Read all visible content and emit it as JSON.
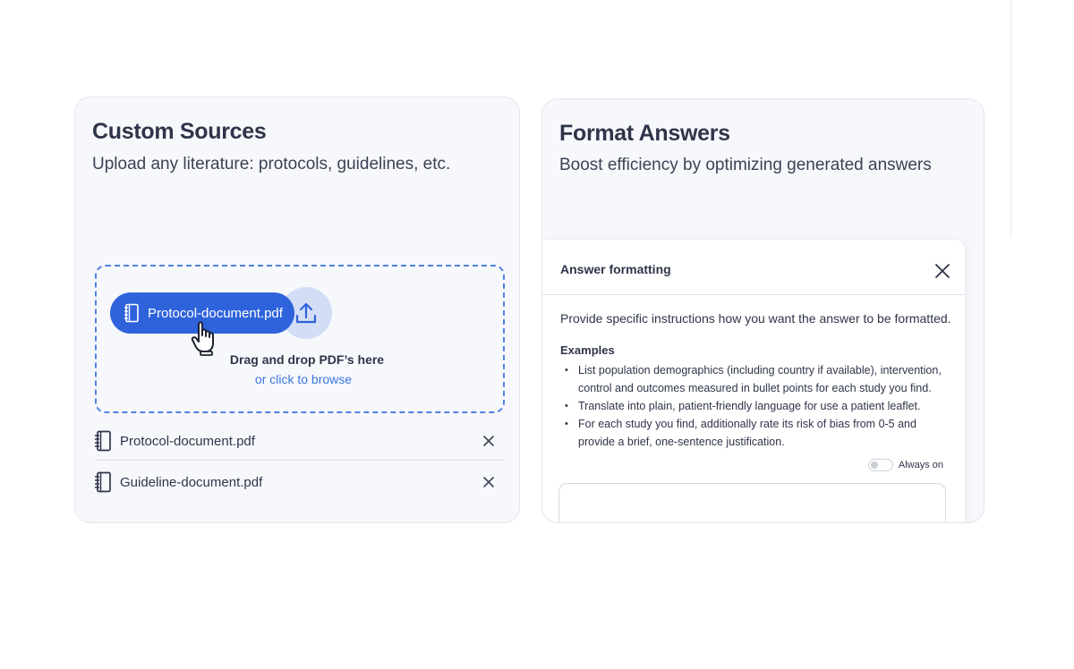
{
  "custom_sources": {
    "title": "Custom Sources",
    "subtitle": "Upload any literature: protocols, guidelines, etc.",
    "dragging_file": "Protocol-document.pdf",
    "drop_text": "Drag and drop PDF’s here",
    "browse_text": "or click to browse",
    "files": [
      {
        "name": "Protocol-document.pdf"
      },
      {
        "name": "Guideline-document.pdf"
      }
    ],
    "colors": {
      "accent": "#2f63dc",
      "link": "#3b78e0"
    }
  },
  "format_answers": {
    "title": "Format Answers",
    "subtitle": "Boost efficiency by optimizing generated answers",
    "dialog": {
      "title": "Answer formatting",
      "instruction": "Provide specific instructions how you want the answer to be formatted.",
      "examples_label": "Examples",
      "examples": [
        "List population demographics (including country if available), intervention, control and outcomes measured in bullet points for each study you find.",
        "Translate into plain, patient-friendly language for use a patient leaflet.",
        "For each study you find, additionally rate its risk of bias from 0-5 and provide a brief, one-sentence justification."
      ],
      "toggle_label": "Always on",
      "toggle_on": false
    }
  }
}
